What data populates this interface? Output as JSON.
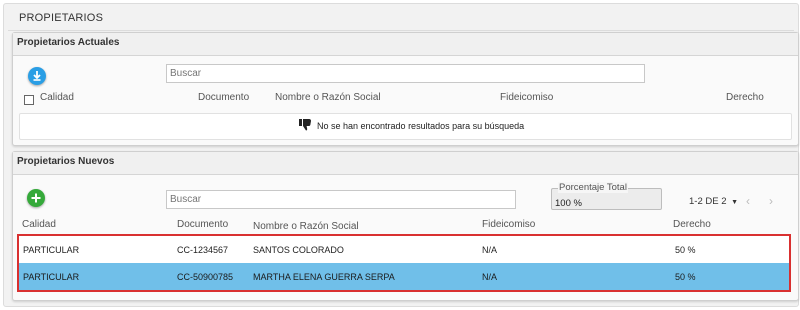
{
  "page": {
    "title": "PROPIETARIOS"
  },
  "actuales": {
    "title": "Propietarios Actuales",
    "search_placeholder": "Buscar",
    "columns": [
      "Calidad",
      "Documento",
      "Nombre o Razón Social",
      "Fideicomiso",
      "Derecho"
    ],
    "empty_message": "No se han encontrado resultados para su búsqueda"
  },
  "nuevos": {
    "title": "Propietarios Nuevos",
    "search_placeholder": "Buscar",
    "porcentaje": {
      "label": "Porcentaje Total",
      "value": "100 %"
    },
    "pager": "1-2 DE 2",
    "columns": [
      "Calidad",
      "Documento",
      "Nombre o Razón Social",
      "Fideicomiso",
      "Derecho"
    ],
    "rows": [
      {
        "calidad": "PARTICULAR",
        "documento": "CC-1234567",
        "nombre": "SANTOS COLORADO",
        "fideicomiso": "N/A",
        "derecho": "50 %"
      },
      {
        "calidad": "PARTICULAR",
        "documento": "CC-50900785",
        "nombre": "MARTHA ELENA GUERRA SERPA",
        "fideicomiso": "N/A",
        "derecho": "50 %"
      }
    ]
  },
  "icons": {
    "download": "download-icon",
    "add": "plus-icon",
    "empty": "thumbs-down-icon",
    "prev": "chevron-left-icon",
    "next": "chevron-right-icon",
    "dropdown": "caret-down-icon"
  },
  "colors": {
    "download_button": "#2a9ee5",
    "add_button": "#35a93a",
    "selected_row": "#70bfe9",
    "highlight_border": "#d93030"
  }
}
